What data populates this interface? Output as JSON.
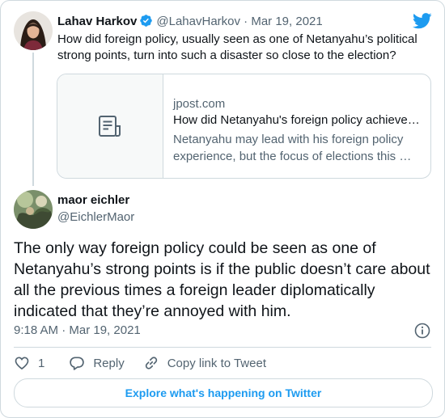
{
  "colors": {
    "accent": "#1d9bf0",
    "secondary_text": "#536471",
    "border": "#cfd9de"
  },
  "parent_tweet": {
    "author_name": "Lahav Harkov",
    "author_handle": "@LahavHarkov",
    "separator": "·",
    "date": "Mar 19, 2021",
    "verified_icon": "verified-badge-icon",
    "text": "How did foreign policy, usually seen as one of Netanyahu’s political strong points, turn into such a disaster so close to the election?",
    "link_card": {
      "thumbnail_icon": "document-icon",
      "domain": "jpost.com",
      "title": "How did Netanyahu's foreign policy achieve…",
      "description": "Netanyahu may lead with his foreign policy experience, but the focus of elections this …"
    }
  },
  "reply_tweet": {
    "author_name": "maor eichler",
    "author_handle": "@EichlerMaor",
    "text": "The only way foreign policy could be seen as one of Netanyahu’s strong points is if the public doesn’t care about all the previous times a foreign leader diplomatically indicated that they’re annoyed with him.",
    "timestamp": "9:18 AM · Mar 19, 2021"
  },
  "actions": {
    "like_count": "1",
    "reply_label": "Reply",
    "copy_link_label": "Copy link to Tweet"
  },
  "explore_label": "Explore what's happening on Twitter"
}
